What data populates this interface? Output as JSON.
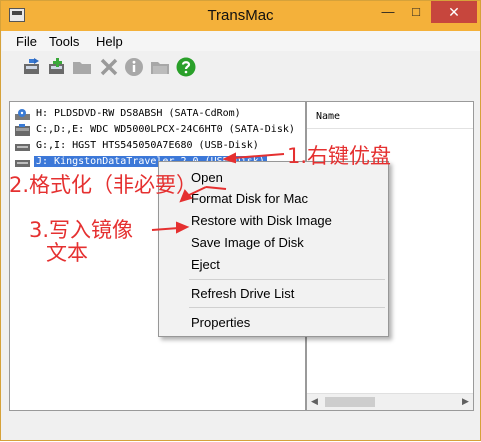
{
  "window": {
    "title": "TransMac",
    "controls": {
      "minimize": "—",
      "maximize": "□",
      "close": "✕"
    }
  },
  "menubar": {
    "items": [
      "File",
      "Tools",
      "Help"
    ]
  },
  "toolbar": {
    "icons": [
      "open-image-icon",
      "add-icon",
      "folder-icon",
      "delete-icon",
      "info-icon",
      "new-folder-icon",
      "help-icon"
    ]
  },
  "drives": [
    {
      "label": "H: PLDSDVD-RW DS8ABSH (SATA-CdRom)",
      "icon": "cdrom-drive-icon"
    },
    {
      "label": "C:,D:,E: WDC WD5000LPCX-24C6HT0 (SATA-Disk)",
      "icon": "hard-disk-icon"
    },
    {
      "label": "G:,I: HGST HTS545050A7E680 (USB-Disk)",
      "icon": "usb-disk-icon"
    },
    {
      "label": "J: KingstonDataTraveler 2.0 (USB-Disk)",
      "icon": "usb-disk-icon",
      "selected": true
    }
  ],
  "file_list": {
    "column_name": "Name"
  },
  "context_menu": {
    "items": [
      "Open",
      "Format Disk for Mac",
      "Restore with Disk Image",
      "Save Image of Disk",
      "Eject",
      "Refresh Drive List",
      "Properties"
    ]
  },
  "annotations": {
    "step1": "1.右键优盘",
    "step2": "2.格式化（非必要）",
    "step3_line1": "3.写入镜像",
    "step3_line2": "文本",
    "color": "#e53030"
  },
  "colors": {
    "titlebar": "#f4b13a",
    "selection": "#3c78d8",
    "close_button": "#c7463d"
  }
}
